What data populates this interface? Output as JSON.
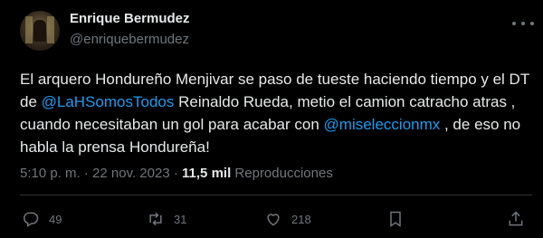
{
  "author": {
    "name": "Enrique Bermudez",
    "handle": "@enriquebermudez"
  },
  "tweet": {
    "segments": [
      {
        "text": "El arquero Hondureño Menjivar se paso de tueste haciendo tiempo y el DT de ",
        "type": "plain"
      },
      {
        "text": "@LaHSomosTodos",
        "type": "mention"
      },
      {
        "text": " Reinaldo Rueda, metio el camion catracho atras , cuando necesitaban un gol para acabar con ",
        "type": "plain"
      },
      {
        "text": "@miseleccionmx",
        "type": "mention"
      },
      {
        "text": " , de eso no habla la prensa Hondureña!",
        "type": "plain"
      }
    ]
  },
  "meta": {
    "time": "5:10 p. m.",
    "separator": " · ",
    "date": "22 nov. 2023",
    "views_count": "11,5 mil",
    "views_label": "Reproducciones"
  },
  "actions": {
    "replies": "49",
    "reposts": "31",
    "likes": "218"
  },
  "icons": [
    "more-options-icon",
    "reply-icon",
    "repost-icon",
    "like-icon",
    "bookmark-icon",
    "share-icon"
  ],
  "colors": {
    "background": "#000000",
    "text": "#e7e9ea",
    "muted": "#71767b",
    "link": "#1d9bf0"
  }
}
